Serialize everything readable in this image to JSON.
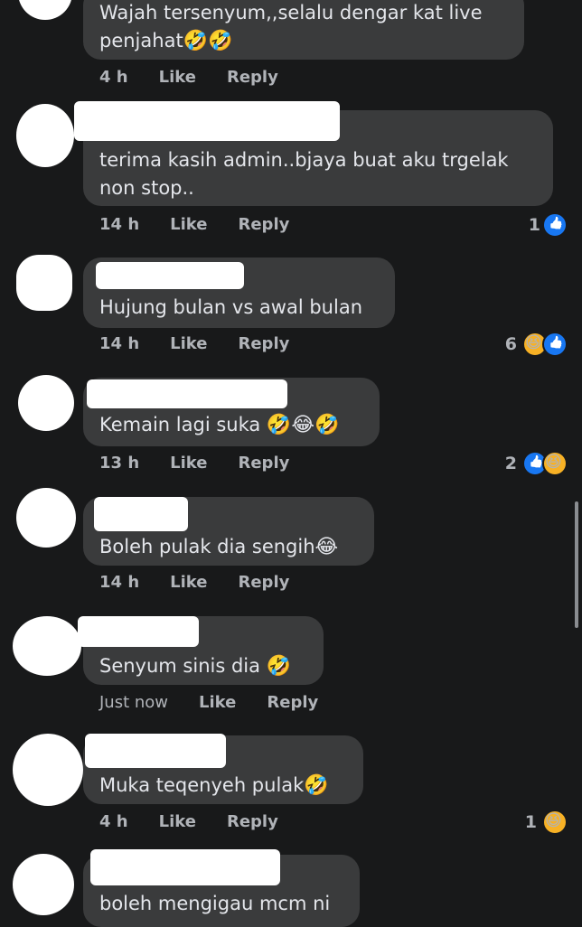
{
  "comments": [
    {
      "text": "Wajah tersenyum,,selalu dengar kat live penjahat",
      "emoji": "🤣🤣",
      "time": "4 h",
      "like": "Like",
      "reply": "Reply",
      "count": "",
      "reactions": []
    },
    {
      "text": "terima kasih admin..bjaya buat aku trgelak non stop..",
      "emoji": "",
      "time": "14 h",
      "like": "Like",
      "reply": "Reply",
      "count": "1",
      "reactions": [
        "like"
      ]
    },
    {
      "text": "Hujung bulan vs awal bulan",
      "emoji": "",
      "time": "14 h",
      "like": "Like",
      "reply": "Reply",
      "count": "6",
      "reactions": [
        "haha",
        "like"
      ]
    },
    {
      "text": "Kemain lagi suka ",
      "emoji": "🤣😂🤣",
      "time": "13 h",
      "like": "Like",
      "reply": "Reply",
      "count": "2",
      "reactions": [
        "like",
        "haha"
      ]
    },
    {
      "text": "Boleh pulak dia sengih",
      "emoji": "😂",
      "time": "14 h",
      "like": "Like",
      "reply": "Reply",
      "count": "",
      "reactions": []
    },
    {
      "text": "Senyum sinis dia ",
      "emoji": "🤣",
      "time": "Just now",
      "like": "Like",
      "reply": "Reply",
      "count": "",
      "reactions": []
    },
    {
      "text": "Muka teqenyeh pulak",
      "emoji": "🤣",
      "time": "4 h",
      "like": "Like",
      "reply": "Reply",
      "count": "1",
      "reactions": [
        "haha"
      ]
    },
    {
      "text": "boleh mengigau mcm ni",
      "emoji": "",
      "time": "",
      "like": "",
      "reply": "",
      "count": "",
      "reactions": []
    }
  ]
}
